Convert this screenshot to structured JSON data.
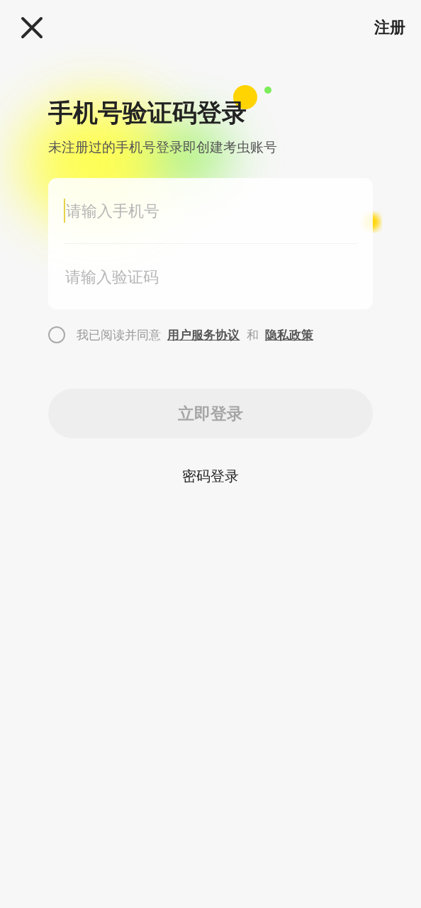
{
  "top_bar": {
    "register": "注册"
  },
  "title": "手机号验证码登录",
  "subtitle": "未注册过的手机号登录即创建考虫账号",
  "fields": [
    {
      "placeholder": "请输入手机号",
      "focused": true
    },
    {
      "placeholder": "请输入验证码",
      "focused": false
    }
  ],
  "agreement": {
    "checked": false,
    "parts": [
      {
        "kind": "text",
        "text": "我已阅读并同意"
      },
      {
        "kind": "link",
        "text": "用户服务协议"
      },
      {
        "kind": "text",
        "text": "和"
      },
      {
        "kind": "link",
        "text": "隐私政策"
      }
    ]
  },
  "login_button": {
    "label": "立即登录",
    "disabled": true
  },
  "password_login": "密码登录"
}
